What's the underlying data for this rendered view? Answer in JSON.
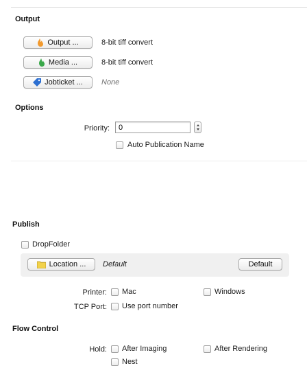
{
  "output_section": {
    "heading": "Output",
    "output_button": {
      "label": "Output ...",
      "icon": "flame-orange-icon",
      "value": "8-bit tiff convert"
    },
    "media_button": {
      "label": "Media ...",
      "icon": "flame-green-icon",
      "value": "8-bit tiff convert"
    },
    "jobticket_button": {
      "label": "Jobticket ...",
      "icon": "tag-blue-icon",
      "value": "None"
    }
  },
  "options_section": {
    "heading": "Options",
    "priority_label": "Priority:",
    "priority_value": "0",
    "auto_publication_label": "Auto Publication Name"
  },
  "publish_section": {
    "heading": "Publish",
    "dropfolder_label": "DropFolder",
    "location_button": {
      "label": "Location ...",
      "icon": "folder-icon"
    },
    "location_value": "Default",
    "default_button": "Default",
    "printer_label": "Printer:",
    "printer_mac": "Mac",
    "printer_windows": "Windows",
    "tcp_port_label": "TCP Port:",
    "tcp_port_option": "Use port number"
  },
  "flow_control_section": {
    "heading": "Flow Control",
    "hold_label": "Hold:",
    "after_imaging": "After Imaging",
    "after_rendering": "After Rendering",
    "nest": "Nest"
  },
  "colors": {
    "flame_orange": "#f29a2e",
    "flame_green": "#3aa84a",
    "tag_blue": "#2c6fd1",
    "folder_yellow": "#f2d24b"
  }
}
